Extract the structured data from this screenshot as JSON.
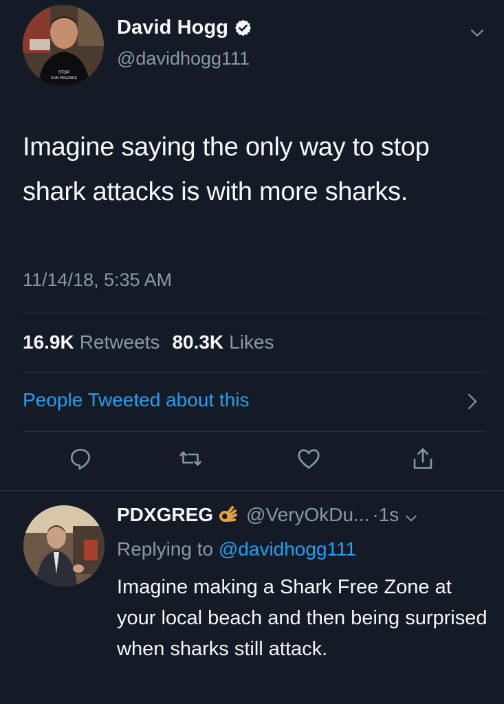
{
  "tweet": {
    "display_name": "David Hogg",
    "handle": "@davidhogg111",
    "avatar_shirt_text_1": "STOP",
    "avatar_shirt_text_2": "GUN VIOLENCE",
    "verified_icon": "verified-badge-icon",
    "text": "Imagine saying the only way to stop shark attacks is with more sharks.",
    "timestamp": "11/14/18, 5:35 AM",
    "retweets_count": "16.9K",
    "retweets_label": "Retweets",
    "likes_count": "80.3K",
    "likes_label": "Likes",
    "people_link": "People Tweeted about this"
  },
  "actions": [
    {
      "name": "reply-icon"
    },
    {
      "name": "retweet-icon"
    },
    {
      "name": "like-icon"
    },
    {
      "name": "share-icon"
    }
  ],
  "reply": {
    "display_name": "PDXGREG",
    "emoji": "👌",
    "handle": "@VeryOkDu...",
    "time": "·1s",
    "replying_prefix": "Replying to",
    "replying_mention": "@davidhogg111",
    "text": "Imagine making a Shark Free Zone at your local beach and then being surprised when sharks still attack."
  },
  "colors": {
    "background": "#151b26",
    "text": "#f5f7fa",
    "secondary": "#8899a6",
    "link": "#1da1f2",
    "divider": "#2b3441"
  }
}
